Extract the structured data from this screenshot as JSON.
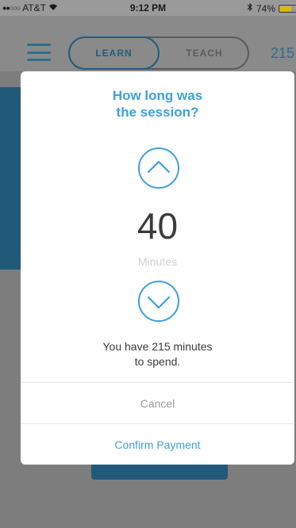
{
  "status_bar": {
    "carrier": "AT&T",
    "time": "9:12 PM",
    "battery": "74%",
    "battery_level": 0.74,
    "icons": [
      "signal-dots-icon",
      "wifi-icon",
      "bluetooth-icon",
      "battery-icon"
    ]
  },
  "header": {
    "tabs": [
      {
        "label": "LEARN",
        "selected": true
      },
      {
        "label": "TEACH",
        "selected": false
      }
    ],
    "count": "215"
  },
  "modal": {
    "title_line1": "How long was",
    "title_line2": "the session?",
    "value": "40",
    "unit": "Minutes",
    "balance_line1": "You have 215 minutes",
    "balance_line2": "to spend.",
    "cancel_label": "Cancel",
    "confirm_label": "Confirm Payment",
    "accent_color": "#3ea0dd"
  }
}
